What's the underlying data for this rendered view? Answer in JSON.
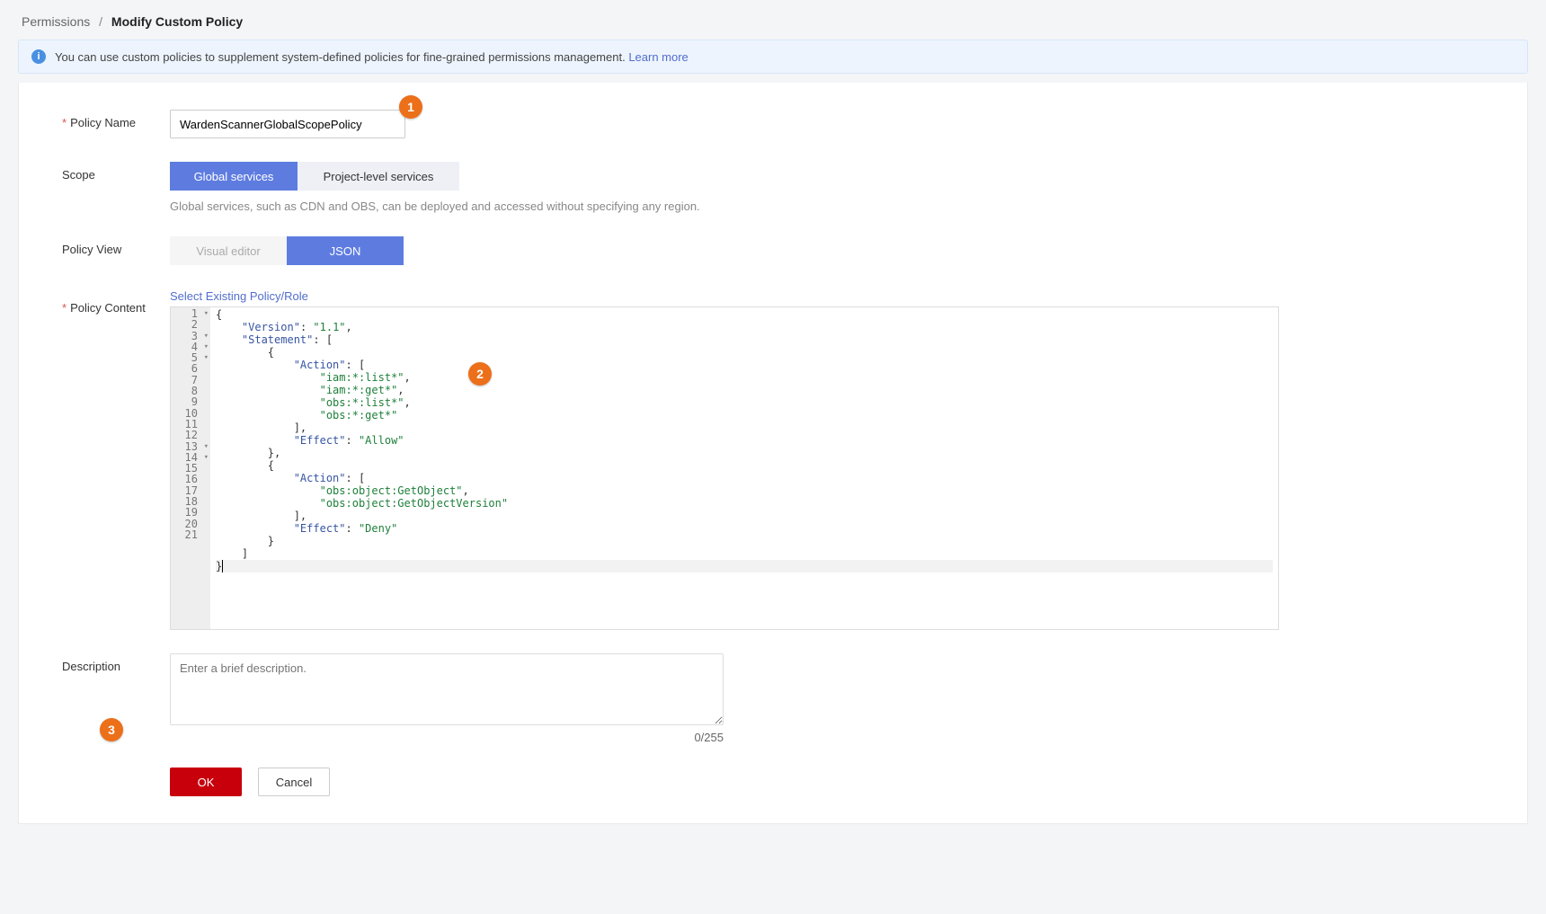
{
  "breadcrumb": {
    "parent": "Permissions",
    "current": "Modify Custom Policy"
  },
  "banner": {
    "text": "You can use custom policies to supplement system-defined policies for fine-grained permissions management.",
    "link_label": "Learn more"
  },
  "labels": {
    "policy_name": "Policy Name",
    "scope": "Scope",
    "policy_view": "Policy View",
    "policy_content": "Policy Content",
    "description": "Description"
  },
  "policy_name_value": "WardenScannerGlobalScopePolicy",
  "scope": {
    "global": "Global services",
    "project": "Project-level services",
    "help": "Global services, such as CDN and OBS, can be deployed and accessed without specifying any region."
  },
  "view": {
    "visual": "Visual editor",
    "json": "JSON"
  },
  "select_existing": "Select Existing Policy/Role",
  "editor": {
    "line_count": 21,
    "fold_lines": [
      1,
      3,
      4,
      5,
      13,
      14
    ]
  },
  "policy_json": {
    "Version": "1.1",
    "Statement": [
      {
        "Action": [
          "iam:*:list*",
          "iam:*:get*",
          "obs:*:list*",
          "obs:*:get*"
        ],
        "Effect": "Allow"
      },
      {
        "Action": [
          "obs:object:GetObject",
          "obs:object:GetObjectVersion"
        ],
        "Effect": "Deny"
      }
    ]
  },
  "description": {
    "value": "",
    "placeholder": "Enter a brief description.",
    "counter": "0/255"
  },
  "buttons": {
    "ok": "OK",
    "cancel": "Cancel"
  },
  "callouts": {
    "one": "1",
    "two": "2",
    "three": "3"
  }
}
